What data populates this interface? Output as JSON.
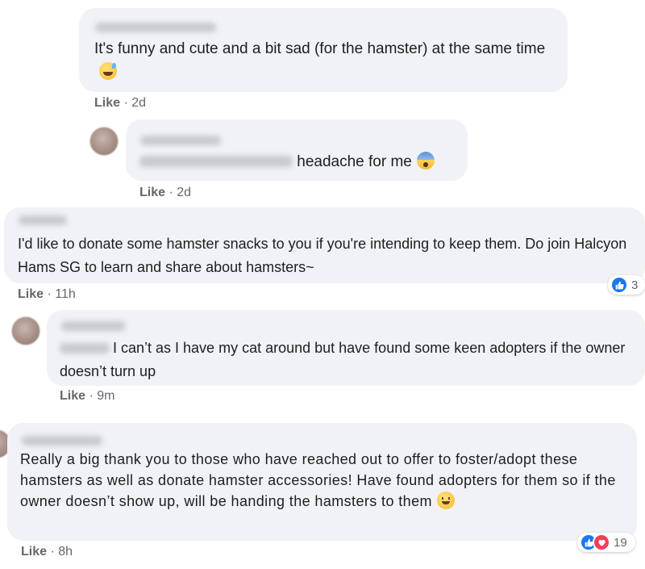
{
  "comments": [
    {
      "text": "It's funny and cute and a bit sad (for the hamster) at the same time",
      "emoji": "grinning-sweat-emoji",
      "like_label": "Like",
      "time": "2d"
    },
    {
      "text": "headache for me",
      "emoji": "fearful-face-emoji",
      "like_label": "Like",
      "time": "2d"
    },
    {
      "text": "I'd like to donate some hamster snacks to you if you're intending to keep them. Do join Halcyon Hams SG to learn and share about hamsters~",
      "like_label": "Like",
      "time": "11h",
      "reactions": {
        "icons": [
          "like-icon"
        ],
        "count": "3"
      }
    },
    {
      "text": "I can’t as I have my cat around but have found some keen adopters if the owner doesn’t turn up",
      "like_label": "Like",
      "time": "9m"
    },
    {
      "text": "Really a big thank you to those who have reached out to offer to foster/adopt these hamsters as well as donate hamster accessories! Have found adopters for them so if the owner doesn’t show up, will be handing the hamsters to them",
      "emoji": "smiling-face-emoji",
      "like_label": "Like",
      "time": "8h",
      "reactions": {
        "icons": [
          "like-icon",
          "love-icon"
        ],
        "count": "19"
      }
    }
  ],
  "meta_separator": " · ",
  "colors": {
    "bubble": "#f0f2f5",
    "meta": "#65676b",
    "like_reaction": "#1877f2",
    "love_reaction": "#f33e58"
  }
}
